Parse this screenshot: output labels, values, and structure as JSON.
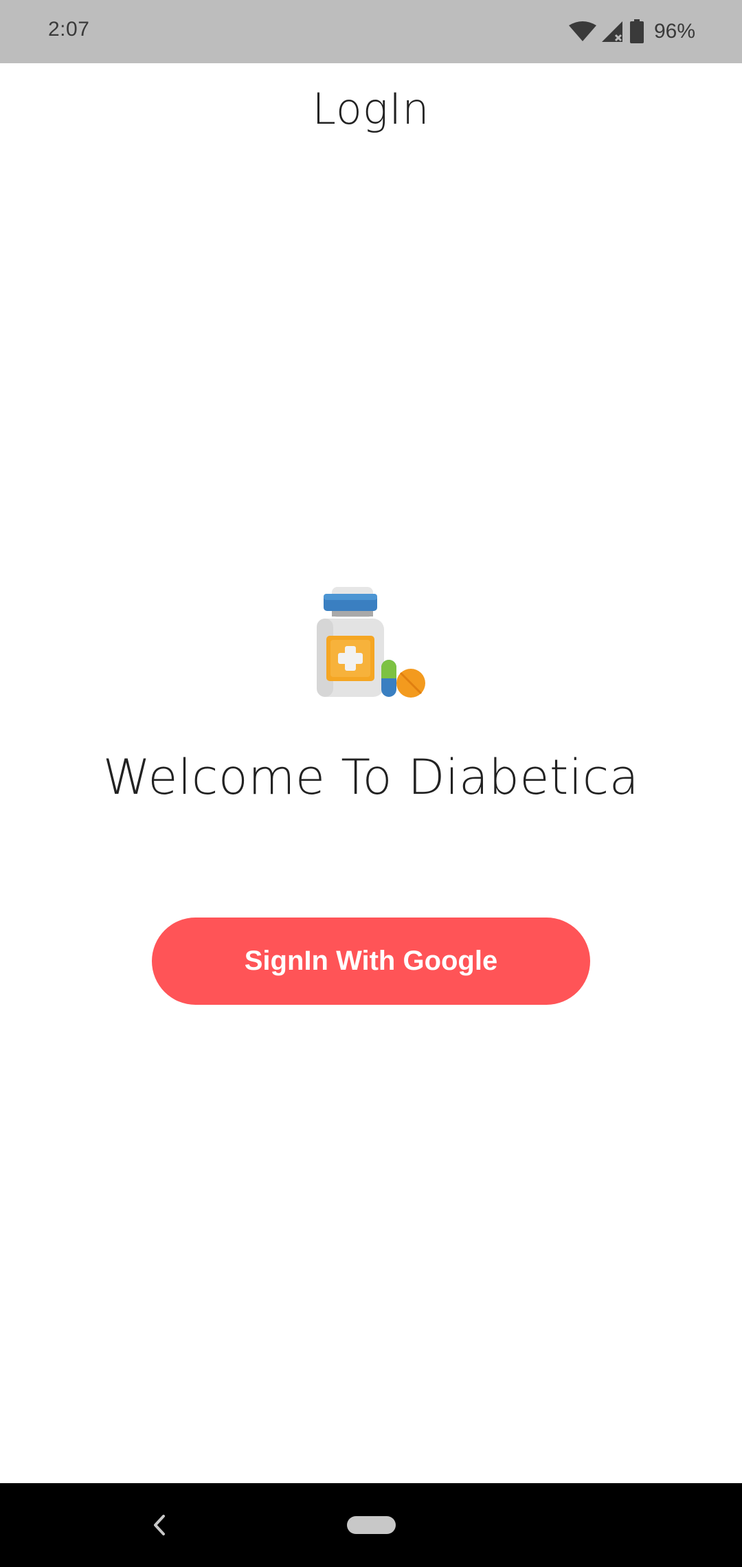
{
  "status_bar": {
    "time": "2:07",
    "battery_percent": "96%",
    "icons": [
      "wifi-icon",
      "signal-icon",
      "battery-icon"
    ]
  },
  "header": {
    "title": "LogIn"
  },
  "main": {
    "logo_icon": "medicine-bottle-icon",
    "welcome_text": "Welcome To Diabetica",
    "signin_button_label": "SignIn With Google"
  },
  "nav_bar": {
    "icons": [
      "back-icon",
      "home-pill-icon"
    ]
  },
  "colors": {
    "accent": "#ff5457",
    "status_bar_bg": "#bdbdbd",
    "nav_bar_bg": "#000000"
  }
}
